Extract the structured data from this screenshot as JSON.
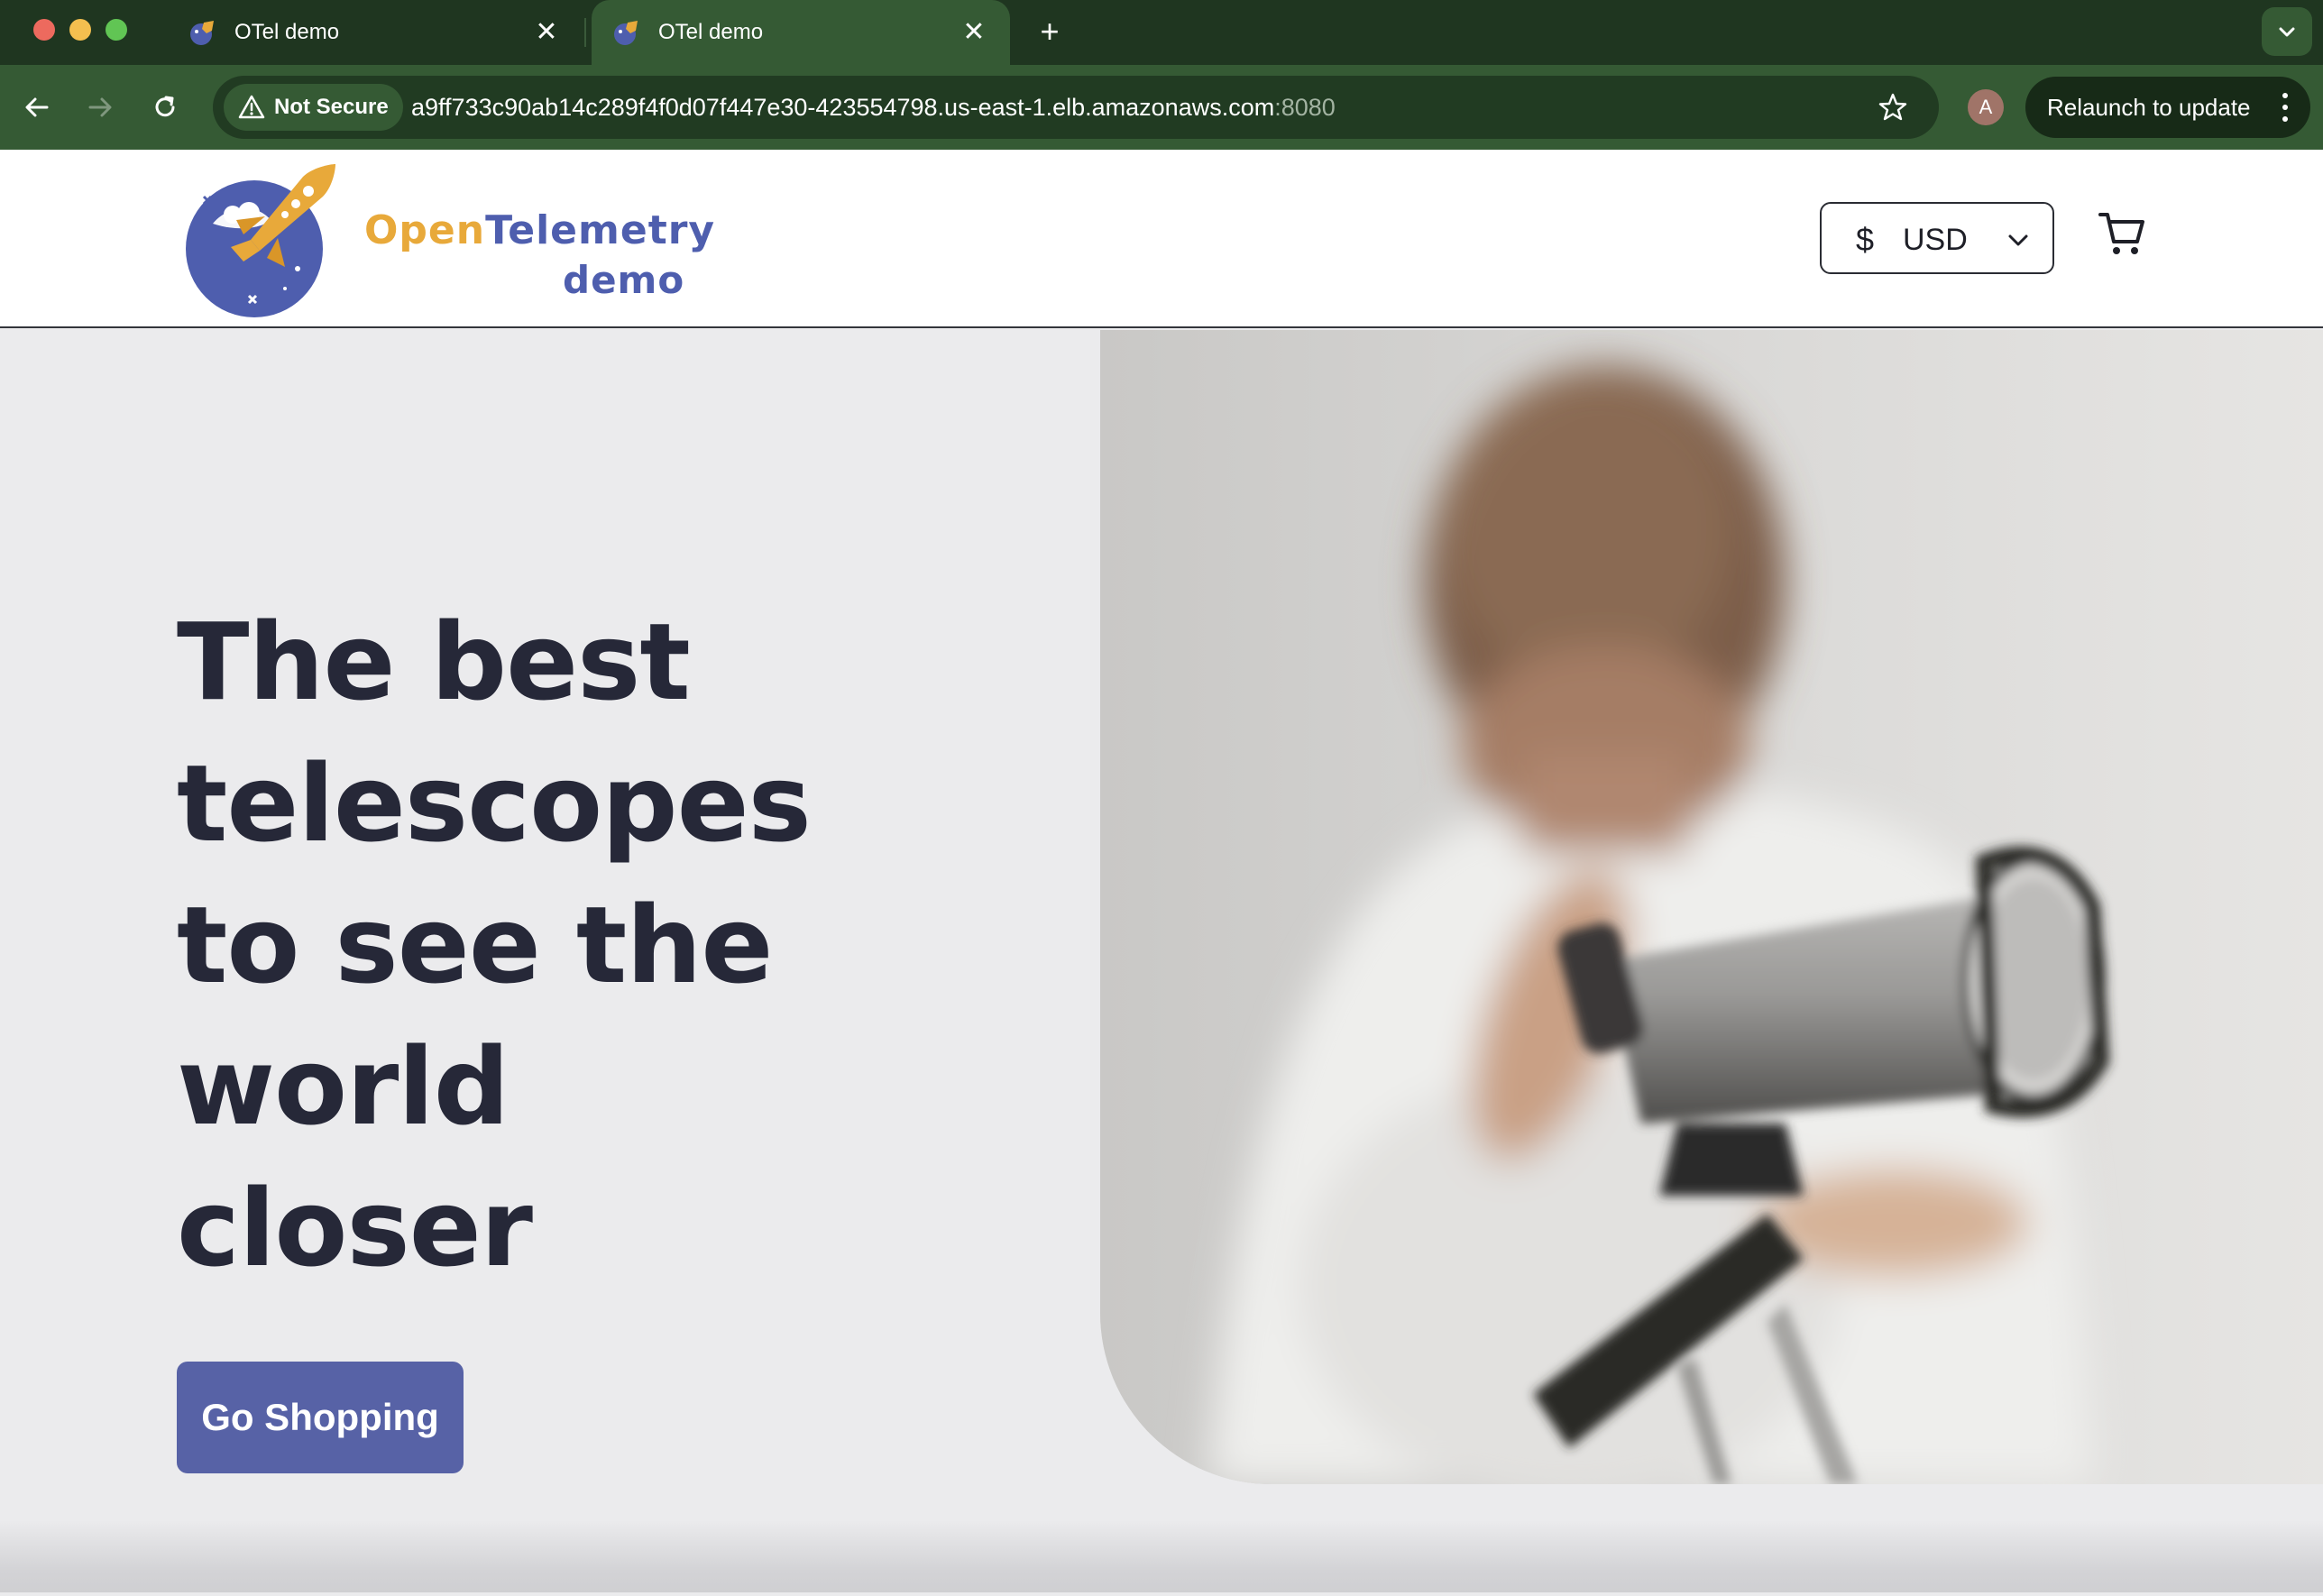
{
  "browser": {
    "tabs": [
      {
        "title": "OTel demo",
        "active": false
      },
      {
        "title": "OTel demo",
        "active": true
      }
    ],
    "new_tab_label": "+",
    "close_glyph": "✕",
    "security_label": "Not Secure",
    "url_host": "a9ff733c90ab14c289f4f0d07f447e30-423554798.us-east-1.elb.amazonaws.com",
    "url_port": ":8080",
    "profile_initial": "A",
    "relaunch_label": "Relaunch to update",
    "icons": [
      "back-arrow-icon",
      "forward-arrow-icon",
      "reload-icon",
      "warning-icon",
      "star-icon",
      "chevron-down-icon",
      "kebab-menu-icon"
    ]
  },
  "header": {
    "logo_word_open": "Open",
    "logo_word_telemetry": "Telemetry",
    "logo_word_demo": "demo",
    "currency_symbol": "$",
    "currency_code": "USD",
    "icons": [
      "rocket-logo-icon",
      "chevron-down-icon",
      "cart-icon"
    ]
  },
  "hero": {
    "headline_lines": [
      "The best",
      "telescopes",
      "to see the",
      "world",
      "closer"
    ],
    "cta_label": "Go Shopping",
    "image": "child-looking-through-telescope"
  },
  "colors": {
    "tab_bar": "#1f3620",
    "toolbar": "#355a34",
    "brand_orange": "#e8a93a",
    "brand_blue": "#4e5eae",
    "cta": "#5762a6",
    "headline": "#262838",
    "hero_bg": "#ebebed"
  }
}
